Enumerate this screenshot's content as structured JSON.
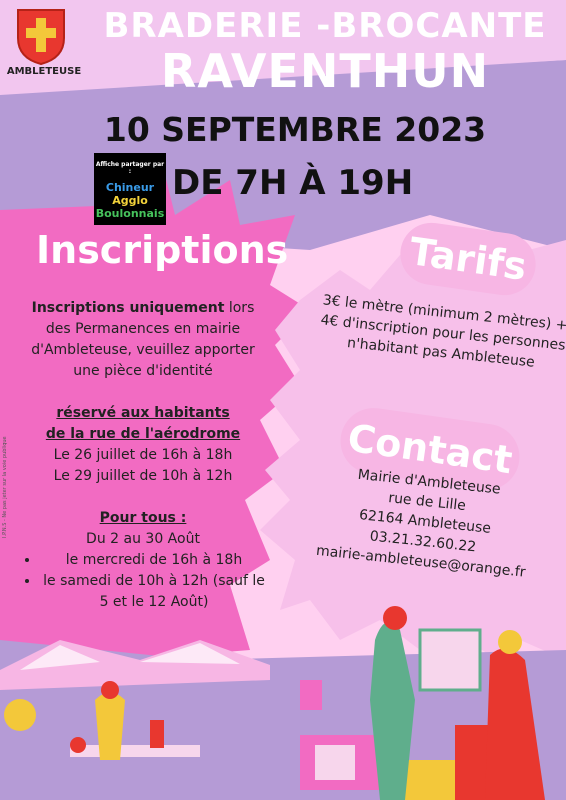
{
  "header": {
    "title_line1": "BRADERIE -BROCANTE",
    "title_line2": "RAVENTHUN",
    "logo_label": "AMBLETEUSE"
  },
  "event": {
    "date": "10 SEPTEMBRE 2023",
    "hours": "DE 7H À 19H"
  },
  "partner": {
    "caption": "Affiche partager par :",
    "line1": "Chineur",
    "line2": "Agglo",
    "line3": "Boulonnais"
  },
  "inscriptions": {
    "title": "Inscriptions",
    "intro_bold": "Inscriptions uniquement",
    "intro_rest": " lors des Permanences en mairie d'Ambleteuse, veuillez apporter une pièce d'identité",
    "residents_heading_1": "réservé aux habitants",
    "residents_heading_2": "de la rue de l'aérodrome",
    "residents_dates": [
      "Le 26 juillet de 16h à 18h",
      "Le 29 juillet de 10h à 12h"
    ],
    "all_heading": "Pour tous :",
    "all_period": "Du 2 au 30 Août",
    "all_items": [
      "le mercredi de 16h à 18h",
      "le samedi de 10h à 12h (sauf le 5 et le 12 Août)"
    ]
  },
  "tarifs": {
    "title": "Tarifs",
    "text": "3€ le mètre (minimum 2 mètres) + 4€ d'inscription pour les personnes n'habitant pas Ambleteuse"
  },
  "contact": {
    "title": "Contact",
    "lines": [
      "Mairie d'Ambleteuse",
      "rue de Lille",
      "62164 Ambleteuse",
      "03.21.32.60.22",
      "mairie-ambleteuse@orange.fr"
    ]
  },
  "side_note": "I.P.N.S - Ne pas jeter sur la voie publique",
  "colors": {
    "background": "#ffd0f0",
    "purple": "#b59bd6",
    "magenta": "#f26bc2",
    "pink_light": "#f7b6e4"
  }
}
